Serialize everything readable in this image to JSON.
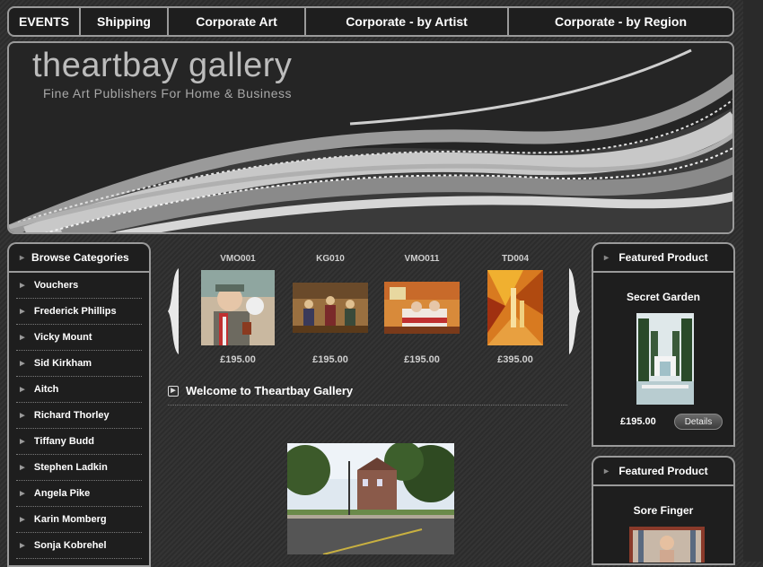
{
  "nav": {
    "items": [
      "EVENTS",
      "Shipping",
      "Corporate Art",
      "Corporate - by Artist",
      "Corporate - by Region"
    ]
  },
  "banner": {
    "title": "theartbay gallery",
    "subtitle": "Fine Art Publishers For Home & Business"
  },
  "sidebar": {
    "heading": "Browse Categories",
    "items": [
      "Vouchers",
      "Frederick Phillips",
      "Vicky Mount",
      "Sid Kirkham",
      "Aitch",
      "Richard Thorley",
      "Tiffany Budd",
      "Stephen Ladkin",
      "Angela Pike",
      "Karin Momberg",
      "Sonja Kobrehel"
    ]
  },
  "carousel": {
    "products": [
      {
        "code": "VMO001",
        "price": "£195.00"
      },
      {
        "code": "KG010",
        "price": "£195.00"
      },
      {
        "code": "VMO011",
        "price": "£195.00"
      },
      {
        "code": "TD004",
        "price": "£395.00"
      }
    ]
  },
  "welcome": {
    "heading": "Welcome to Theartbay Gallery"
  },
  "featured": [
    {
      "heading": "Featured Product",
      "title": "Secret Garden",
      "price": "£195.00",
      "button": "Details"
    },
    {
      "heading": "Featured Product",
      "title": "Sore Finger"
    }
  ]
}
